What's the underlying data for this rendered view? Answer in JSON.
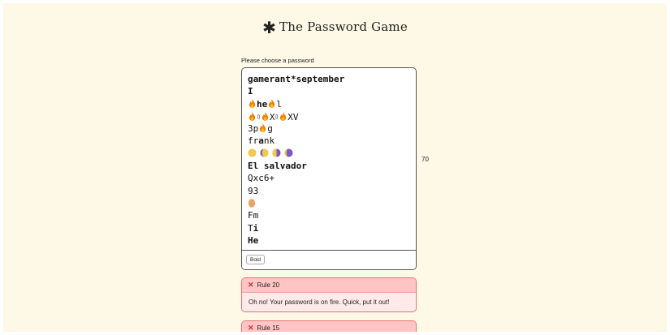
{
  "header": {
    "title": "The Password Game"
  },
  "password": {
    "prompt": "Please choose a password",
    "line1": "gamerant*september",
    "line2": "I",
    "line3_he": "he",
    "line3_l": "l",
    "line4_x": "X",
    "line4_xv": "XV",
    "line5_3p": "3p",
    "line5_g": "g",
    "line6_fr": "fr",
    "line6_a": "a",
    "line6_nk": "nk",
    "line8": "El salvador",
    "line9": "Qxc6+",
    "line10": "93",
    "line12": "Fm",
    "line13_T": "T",
    "line13_i": "i",
    "line14": "He",
    "bold_label": "Bold",
    "char_count": "70"
  },
  "rules": [
    {
      "label": "Rule 20",
      "text": "Oh no! Your password is on fire. Quick, put it out!"
    },
    {
      "label": "Rule 15",
      "text": ""
    }
  ],
  "colors": {
    "background": "#fdf9e6",
    "rule_error_border": "#e57373",
    "rule_error_header": "#ffc4c4",
    "fire": "#f57c00"
  }
}
